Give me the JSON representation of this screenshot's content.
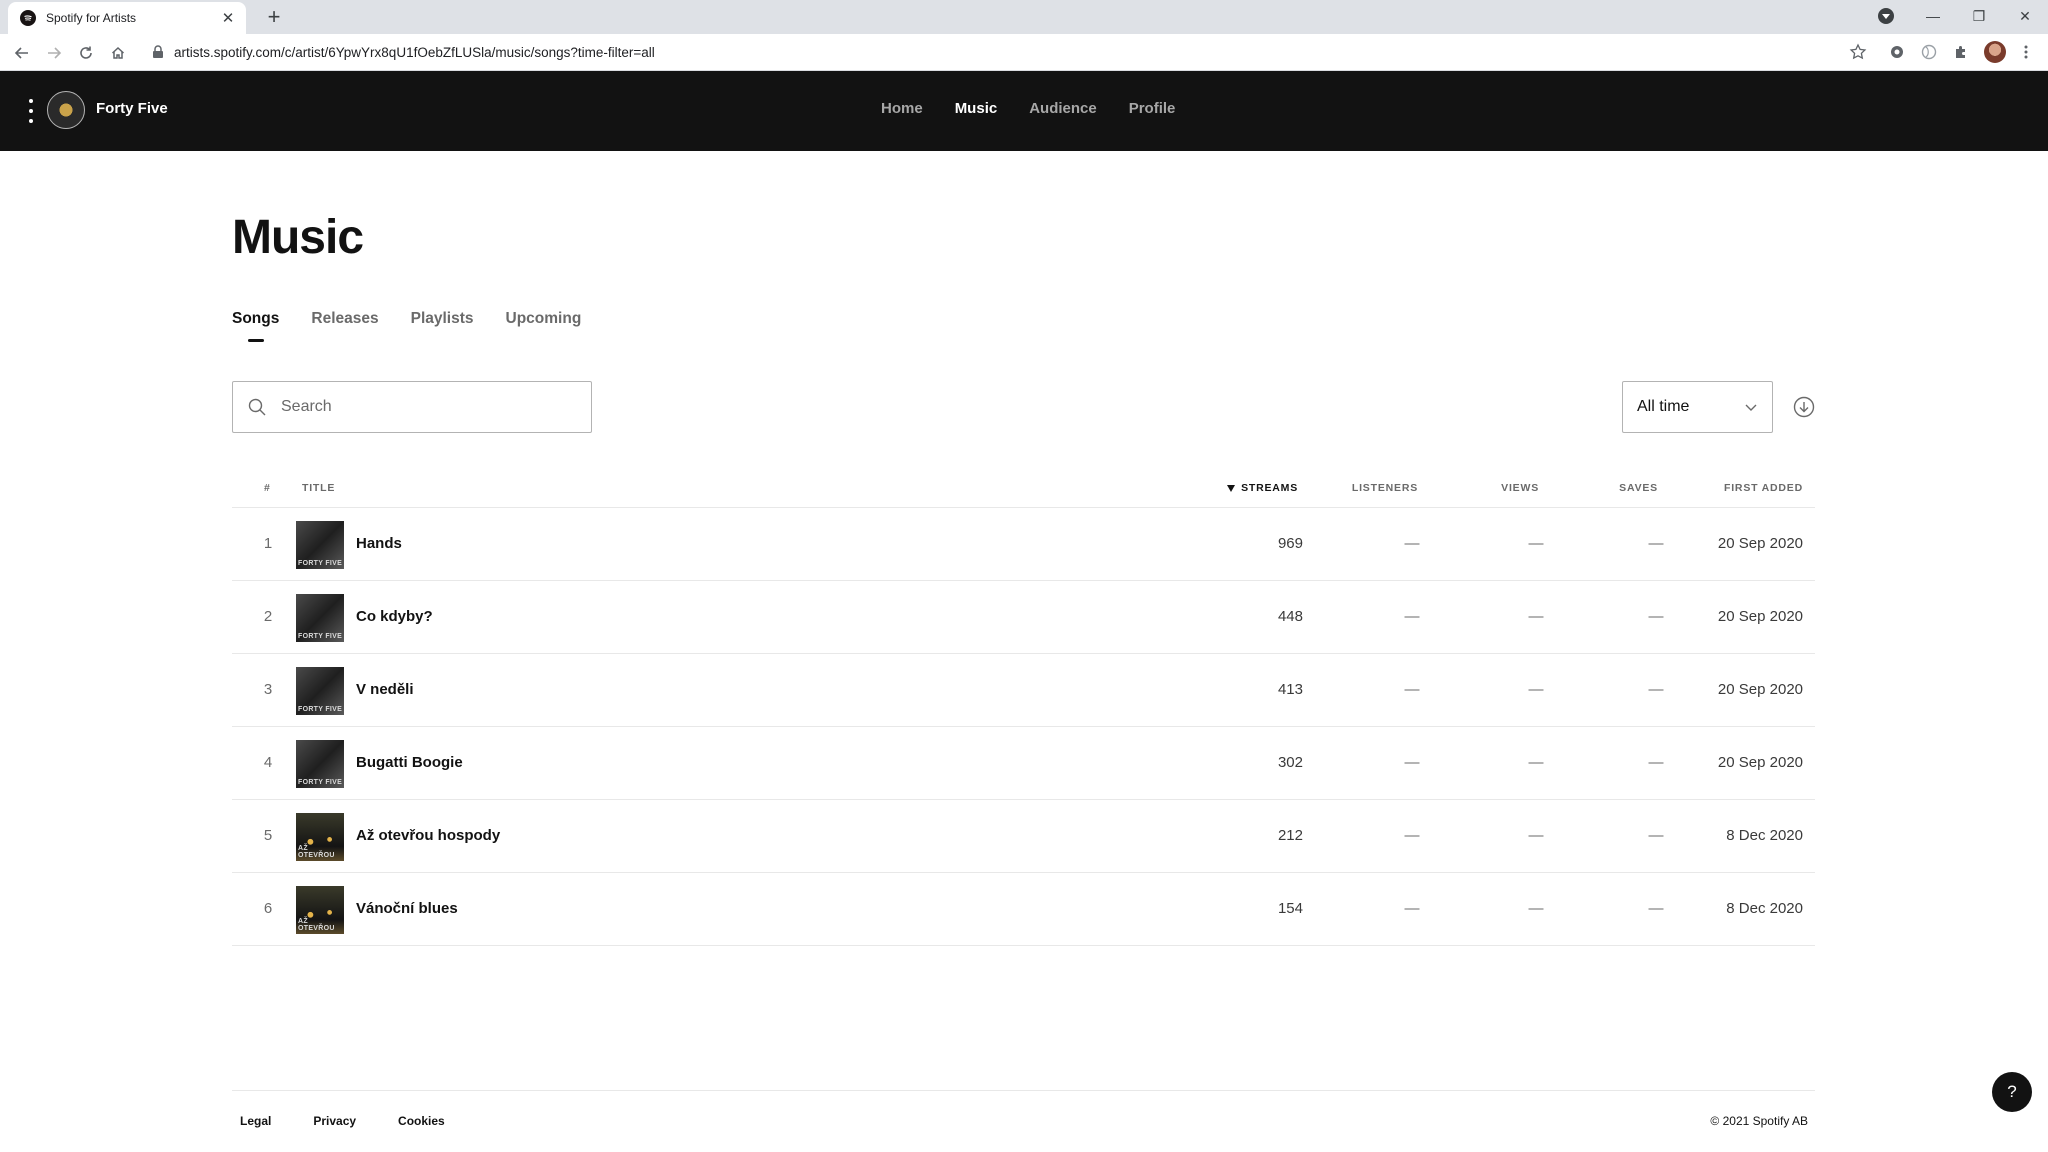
{
  "browser": {
    "tab_title": "Spotify for Artists",
    "url": "artists.spotify.com/c/artist/6YpwYrx8qU1fOebZfLUSla/music/songs?time-filter=all"
  },
  "header": {
    "artist_name": "Forty Five",
    "nav": [
      "Home",
      "Music",
      "Audience",
      "Profile"
    ],
    "active_nav": "Music"
  },
  "page": {
    "title": "Music",
    "tabs": [
      "Songs",
      "Releases",
      "Playlists",
      "Upcoming"
    ],
    "active_tab": "Songs"
  },
  "search": {
    "placeholder": "Search",
    "value": ""
  },
  "time_filter": {
    "selected": "All time"
  },
  "table": {
    "columns": {
      "num": "#",
      "title": "TITLE",
      "streams": "STREAMS",
      "listeners": "LISTENERS",
      "views": "VIEWS",
      "saves": "SAVES",
      "first_added": "FIRST ADDED"
    },
    "rows": [
      {
        "num": "1",
        "title": "Hands",
        "streams": "969",
        "listeners": "—",
        "views": "—",
        "saves": "—",
        "first_added": "20 Sep 2020",
        "cover_caption": "FORTY FIVE"
      },
      {
        "num": "2",
        "title": "Co kdyby?",
        "streams": "448",
        "listeners": "—",
        "views": "—",
        "saves": "—",
        "first_added": "20 Sep 2020",
        "cover_caption": "FORTY FIVE"
      },
      {
        "num": "3",
        "title": "V neděli",
        "streams": "413",
        "listeners": "—",
        "views": "—",
        "saves": "—",
        "first_added": "20 Sep 2020",
        "cover_caption": "FORTY FIVE"
      },
      {
        "num": "4",
        "title": "Bugatti Boogie",
        "streams": "302",
        "listeners": "—",
        "views": "—",
        "saves": "—",
        "first_added": "20 Sep 2020",
        "cover_caption": "FORTY FIVE"
      },
      {
        "num": "5",
        "title": "Až otevřou hospody",
        "streams": "212",
        "listeners": "—",
        "views": "—",
        "saves": "—",
        "first_added": "8 Dec 2020",
        "cover_caption": "AŽ OTEVŘOU"
      },
      {
        "num": "6",
        "title": "Vánoční blues",
        "streams": "154",
        "listeners": "—",
        "views": "—",
        "saves": "—",
        "first_added": "8 Dec 2020",
        "cover_caption": "AŽ OTEVŘOU"
      }
    ]
  },
  "footer": {
    "links": [
      "Legal",
      "Privacy",
      "Cookies"
    ],
    "copyright": "© 2021 Spotify AB"
  },
  "help": {
    "label": "?"
  }
}
